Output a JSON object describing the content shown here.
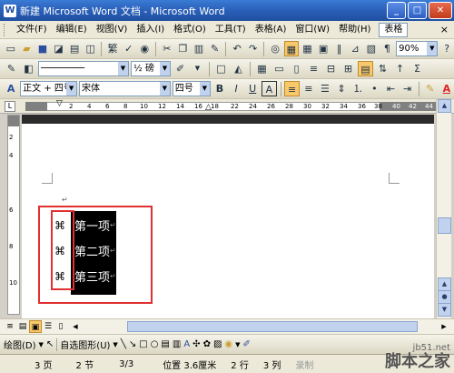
{
  "window": {
    "title": "新建 Microsoft Word 文档 - Microsoft Word",
    "minimize": "_",
    "maximize": "□",
    "close": "✕"
  },
  "menu": {
    "items": [
      "文件(F)",
      "编辑(E)",
      "视图(V)",
      "插入(I)",
      "格式(O)",
      "工具(T)",
      "表格(A)",
      "窗口(W)",
      "帮助(H)"
    ],
    "help_search": "表格",
    "close_doc": "×"
  },
  "toolbar_standard": {
    "zoom": "90%"
  },
  "toolbar_table": {
    "line_weight": "½ 磅",
    "dash_sample": "────────"
  },
  "toolbar_format": {
    "style": "正文 + 四号",
    "font": "宋体",
    "size": "四号",
    "bold": "B",
    "italic": "I",
    "underline": "U",
    "char_border": "A",
    "font_color": "A"
  },
  "ruler": {
    "tab_selector": "L",
    "marks": [
      "2",
      "4",
      "6",
      "8",
      "10",
      "12",
      "14",
      "16",
      "18",
      "22",
      "24",
      "26",
      "28",
      "30",
      "32",
      "34",
      "36",
      "38",
      "40",
      "42",
      "44"
    ],
    "vmarks": [
      "2",
      "4",
      "6",
      "8",
      "10"
    ]
  },
  "document": {
    "para_mark": "↵",
    "bullet_symbol": "⌘",
    "items": [
      "第一项",
      "第二项",
      "第三项"
    ]
  },
  "draw_toolbar": {
    "draw": "绘图(D)",
    "autoshapes": "自选图形(U)"
  },
  "status": {
    "page": "3 页",
    "section": "2 节",
    "pages": "3/3",
    "position": "位置 3.6厘米",
    "line": "2 行",
    "col": "3 列",
    "rec": "录制"
  },
  "watermark": {
    "url": "jb51.net",
    "name": "脚本之家"
  },
  "colors": {
    "highlight_box": "#e03030",
    "selection": "#000000"
  }
}
